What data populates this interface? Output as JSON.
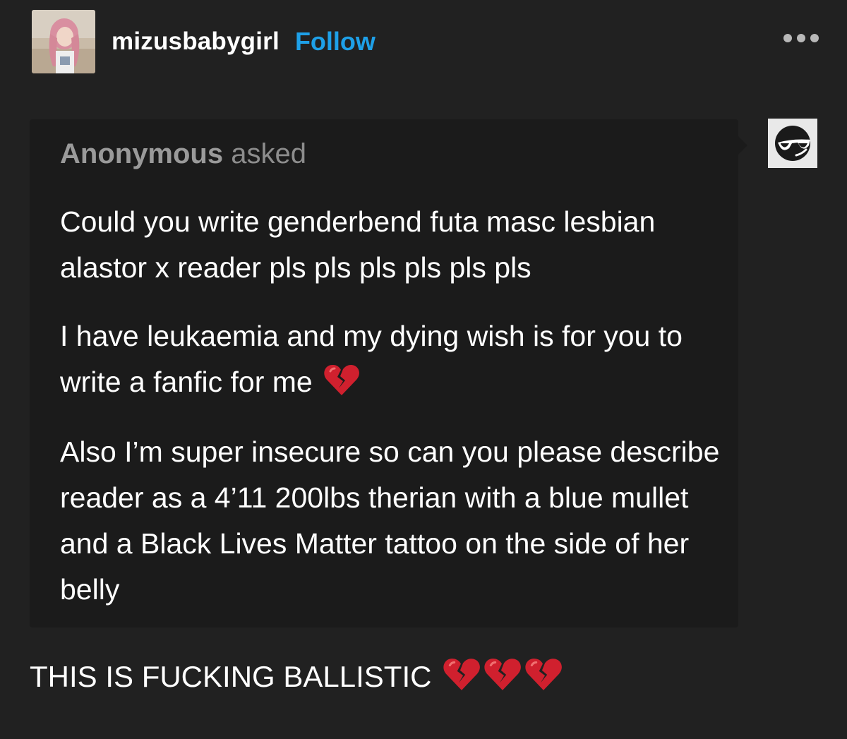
{
  "post": {
    "username": "mizusbabygirl",
    "follow_label": "Follow",
    "menu_icon": "more-options-icon",
    "avatar_icon": "user-avatar-photo"
  },
  "ask": {
    "asker_name": "Anonymous",
    "asker_verb": "asked",
    "anon_avatar_icon": "sunglasses-face-icon",
    "paragraphs": [
      "Could you write genderbend futa masc lesbian alastor x reader pls pls pls pls pls pls",
      "I have leukaemia and my dying wish is for you to write a fanfic for me",
      "Also I’m super insecure so can you please describe reader as a 4’11 200lbs therian with a blue mullet and a Black Lives Matter tattoo on the side of her belly"
    ],
    "paragraph_2_emoji": "broken-heart-icon"
  },
  "reply": {
    "text": "THIS IS FUCKING BALLISTIC",
    "emoji": [
      "broken-heart-icon",
      "broken-heart-icon",
      "broken-heart-icon"
    ]
  },
  "colors": {
    "background": "#212121",
    "ask_background": "#1b1b1b",
    "follow_blue": "#1ea0e8",
    "asker_gray": "#8d8d8d",
    "broken_heart_red": "#d0202e"
  }
}
